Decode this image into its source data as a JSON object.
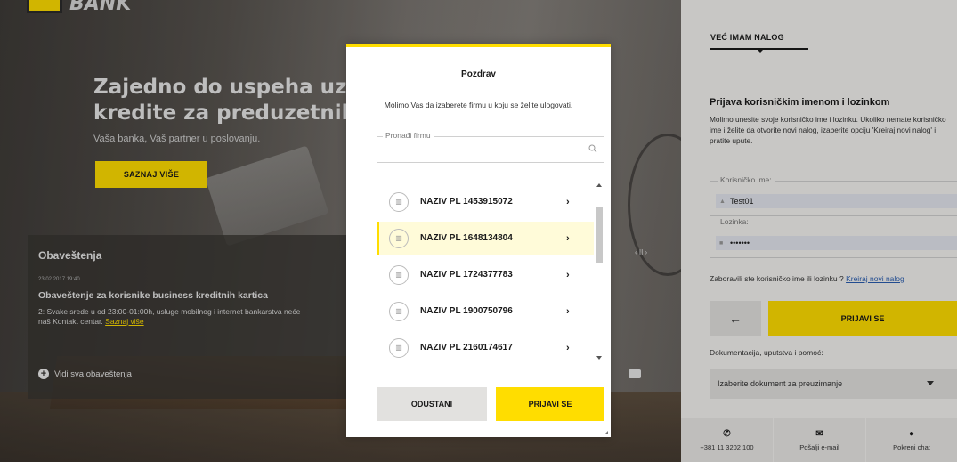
{
  "brand": {
    "name": "BANK"
  },
  "hero": {
    "title": "Zajedno do uspeha uz kredite za preduzetnike",
    "subtitle": "Vaša banka, Vaš partner u poslovanju.",
    "cta_label": "SAZNAJ VIŠE"
  },
  "notices": {
    "title": "Obaveštenja",
    "date": "23.02.2017 19:40",
    "headline": "Obaveštenje za korisnike business kreditnih kartica",
    "body": "2: Svake srede u od 23:00-01:00h, usluge mobilnog i internet bankarstva neće",
    "body2": "naš Kontakt centar.",
    "more_link": "Saznaj više",
    "all_label": "Vidi sva obaveštenja",
    "pager": "‹ II ›"
  },
  "login_panel": {
    "tab": "VEĆ IMAM NALOG",
    "heading": "Prijava korisničkim imenom i lozinkom",
    "instructions": "Molimo unesite svoje korisničko ime i lozinku. Ukoliko nemate korisničko ime i želite da otvorite novi nalog, izaberite opciju 'Kreiraj novi nalog' i pratite upute.",
    "username": {
      "label": "Korisničko ime:",
      "value": "Test01"
    },
    "password": {
      "label": "Lozinka:",
      "value": "•••••••"
    },
    "forgot_text": "Zaboravili ste korisničko ime ili lozinku ?",
    "create_link": "Kreiraj novi nalog",
    "back_label": "←",
    "login_label": "PRIJAVI SE",
    "docs_label": "Dokumentacija, uputstva i pomoć:",
    "docs_select": "Izaberite dokument za preuzimanje",
    "contacts": [
      {
        "icon": "phone-icon",
        "glyph": "✆",
        "text": "+381 11 3202 100"
      },
      {
        "icon": "mail-icon",
        "glyph": "✉",
        "text": "Pošalji e-mail"
      },
      {
        "icon": "chat-icon",
        "glyph": "●",
        "text": "Pokreni chat"
      }
    ]
  },
  "modal": {
    "title": "Pozdrav",
    "subtitle": "Molimo Vas da izaberete firmu u koju se želite ulogovati.",
    "search_label": "Pronađi firmu",
    "companies": [
      {
        "name": "NAZIV PL 1453915072",
        "selected": false
      },
      {
        "name": "NAZIV PL 1648134804",
        "selected": true
      },
      {
        "name": "NAZIV PL 1724377783",
        "selected": false
      },
      {
        "name": "NAZIV PL 1900750796",
        "selected": false
      },
      {
        "name": "NAZIV PL 2160174617",
        "selected": false
      }
    ],
    "cancel_label": "ODUSTANI",
    "confirm_label": "PRIJAVI SE"
  },
  "colors": {
    "accent": "#ffdd00",
    "link": "#2a5db0",
    "selected_row": "#fffbd9"
  }
}
